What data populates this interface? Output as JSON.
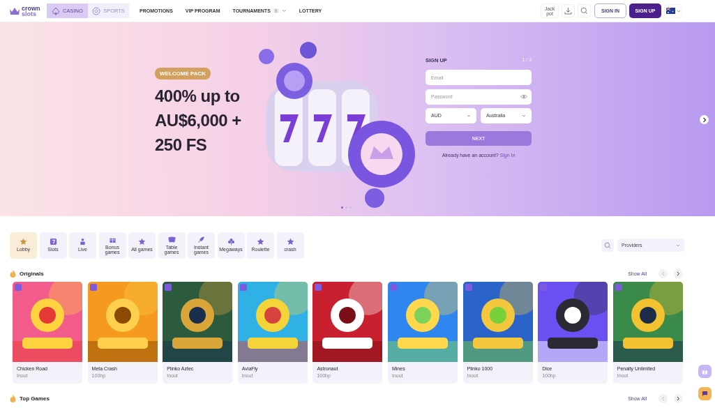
{
  "header": {
    "logo": {
      "line_1": "crown",
      "line_2": "slots"
    },
    "modes": [
      {
        "label": "CASINO",
        "selected": true
      },
      {
        "label": "SPORTS",
        "selected": false
      }
    ],
    "nav": [
      {
        "label": "PROMOTIONS",
        "kind": "link"
      },
      {
        "label": "VIP PROGRAM",
        "kind": "link"
      },
      {
        "label": "TOURNAMENTS",
        "kind": "dropdown",
        "badge": "8"
      },
      {
        "label": "LOTTERY",
        "kind": "link"
      }
    ],
    "jackpot_button": "Jack pot",
    "sign_in": "SIGN IN",
    "sign_up": "SIGN UP"
  },
  "hero": {
    "badge": "WELCOME PACK",
    "headline": [
      "400% up to",
      "AU$6,000 +",
      "250 FS"
    ],
    "form": {
      "title": "SIGN UP",
      "step": "1 / 3",
      "email": {
        "placeholder": "Email"
      },
      "password": {
        "placeholder": "Password"
      },
      "currency": "AUD",
      "country": "Australia",
      "submit": "NEXT",
      "footer": "Already have an account?",
      "footer_link": "Sign In"
    },
    "slides": [
      {
        "selected": true
      },
      {
        "selected": false
      },
      {
        "selected": false
      }
    ]
  },
  "categories": [
    {
      "label": "Lobby",
      "selected": true
    },
    {
      "label": "Slots",
      "selected": false
    },
    {
      "label": "Live",
      "selected": false
    },
    {
      "label": "Bonus games",
      "selected": false
    },
    {
      "label": "All games",
      "selected": false
    },
    {
      "label": "Table games",
      "selected": false
    },
    {
      "label": "Instant games",
      "selected": false
    },
    {
      "label": "Megaways",
      "selected": false
    },
    {
      "label": "Roulette",
      "selected": false
    },
    {
      "label": "crash",
      "selected": false
    }
  ],
  "providers_select": {
    "placeholder": "Providers"
  },
  "sections": [
    {
      "title": "Originals",
      "show_all": "Show All",
      "games": [
        {
          "title": "Chicken Road",
          "provider": "Inout"
        },
        {
          "title": "Meta Crash",
          "provider": "100hp"
        },
        {
          "title": "Plinko Aztec",
          "provider": "Inout"
        },
        {
          "title": "AviaFly",
          "provider": "Inout"
        },
        {
          "title": "Astronaut",
          "provider": "100hp"
        },
        {
          "title": "Mines",
          "provider": "Inout"
        },
        {
          "title": "Plinko 1000",
          "provider": "Inout"
        },
        {
          "title": "Dice",
          "provider": "100hp"
        },
        {
          "title": "Penalty Unlimited",
          "provider": "Inout"
        }
      ]
    },
    {
      "title": "Top Games",
      "show_all": "Show All"
    }
  ]
}
